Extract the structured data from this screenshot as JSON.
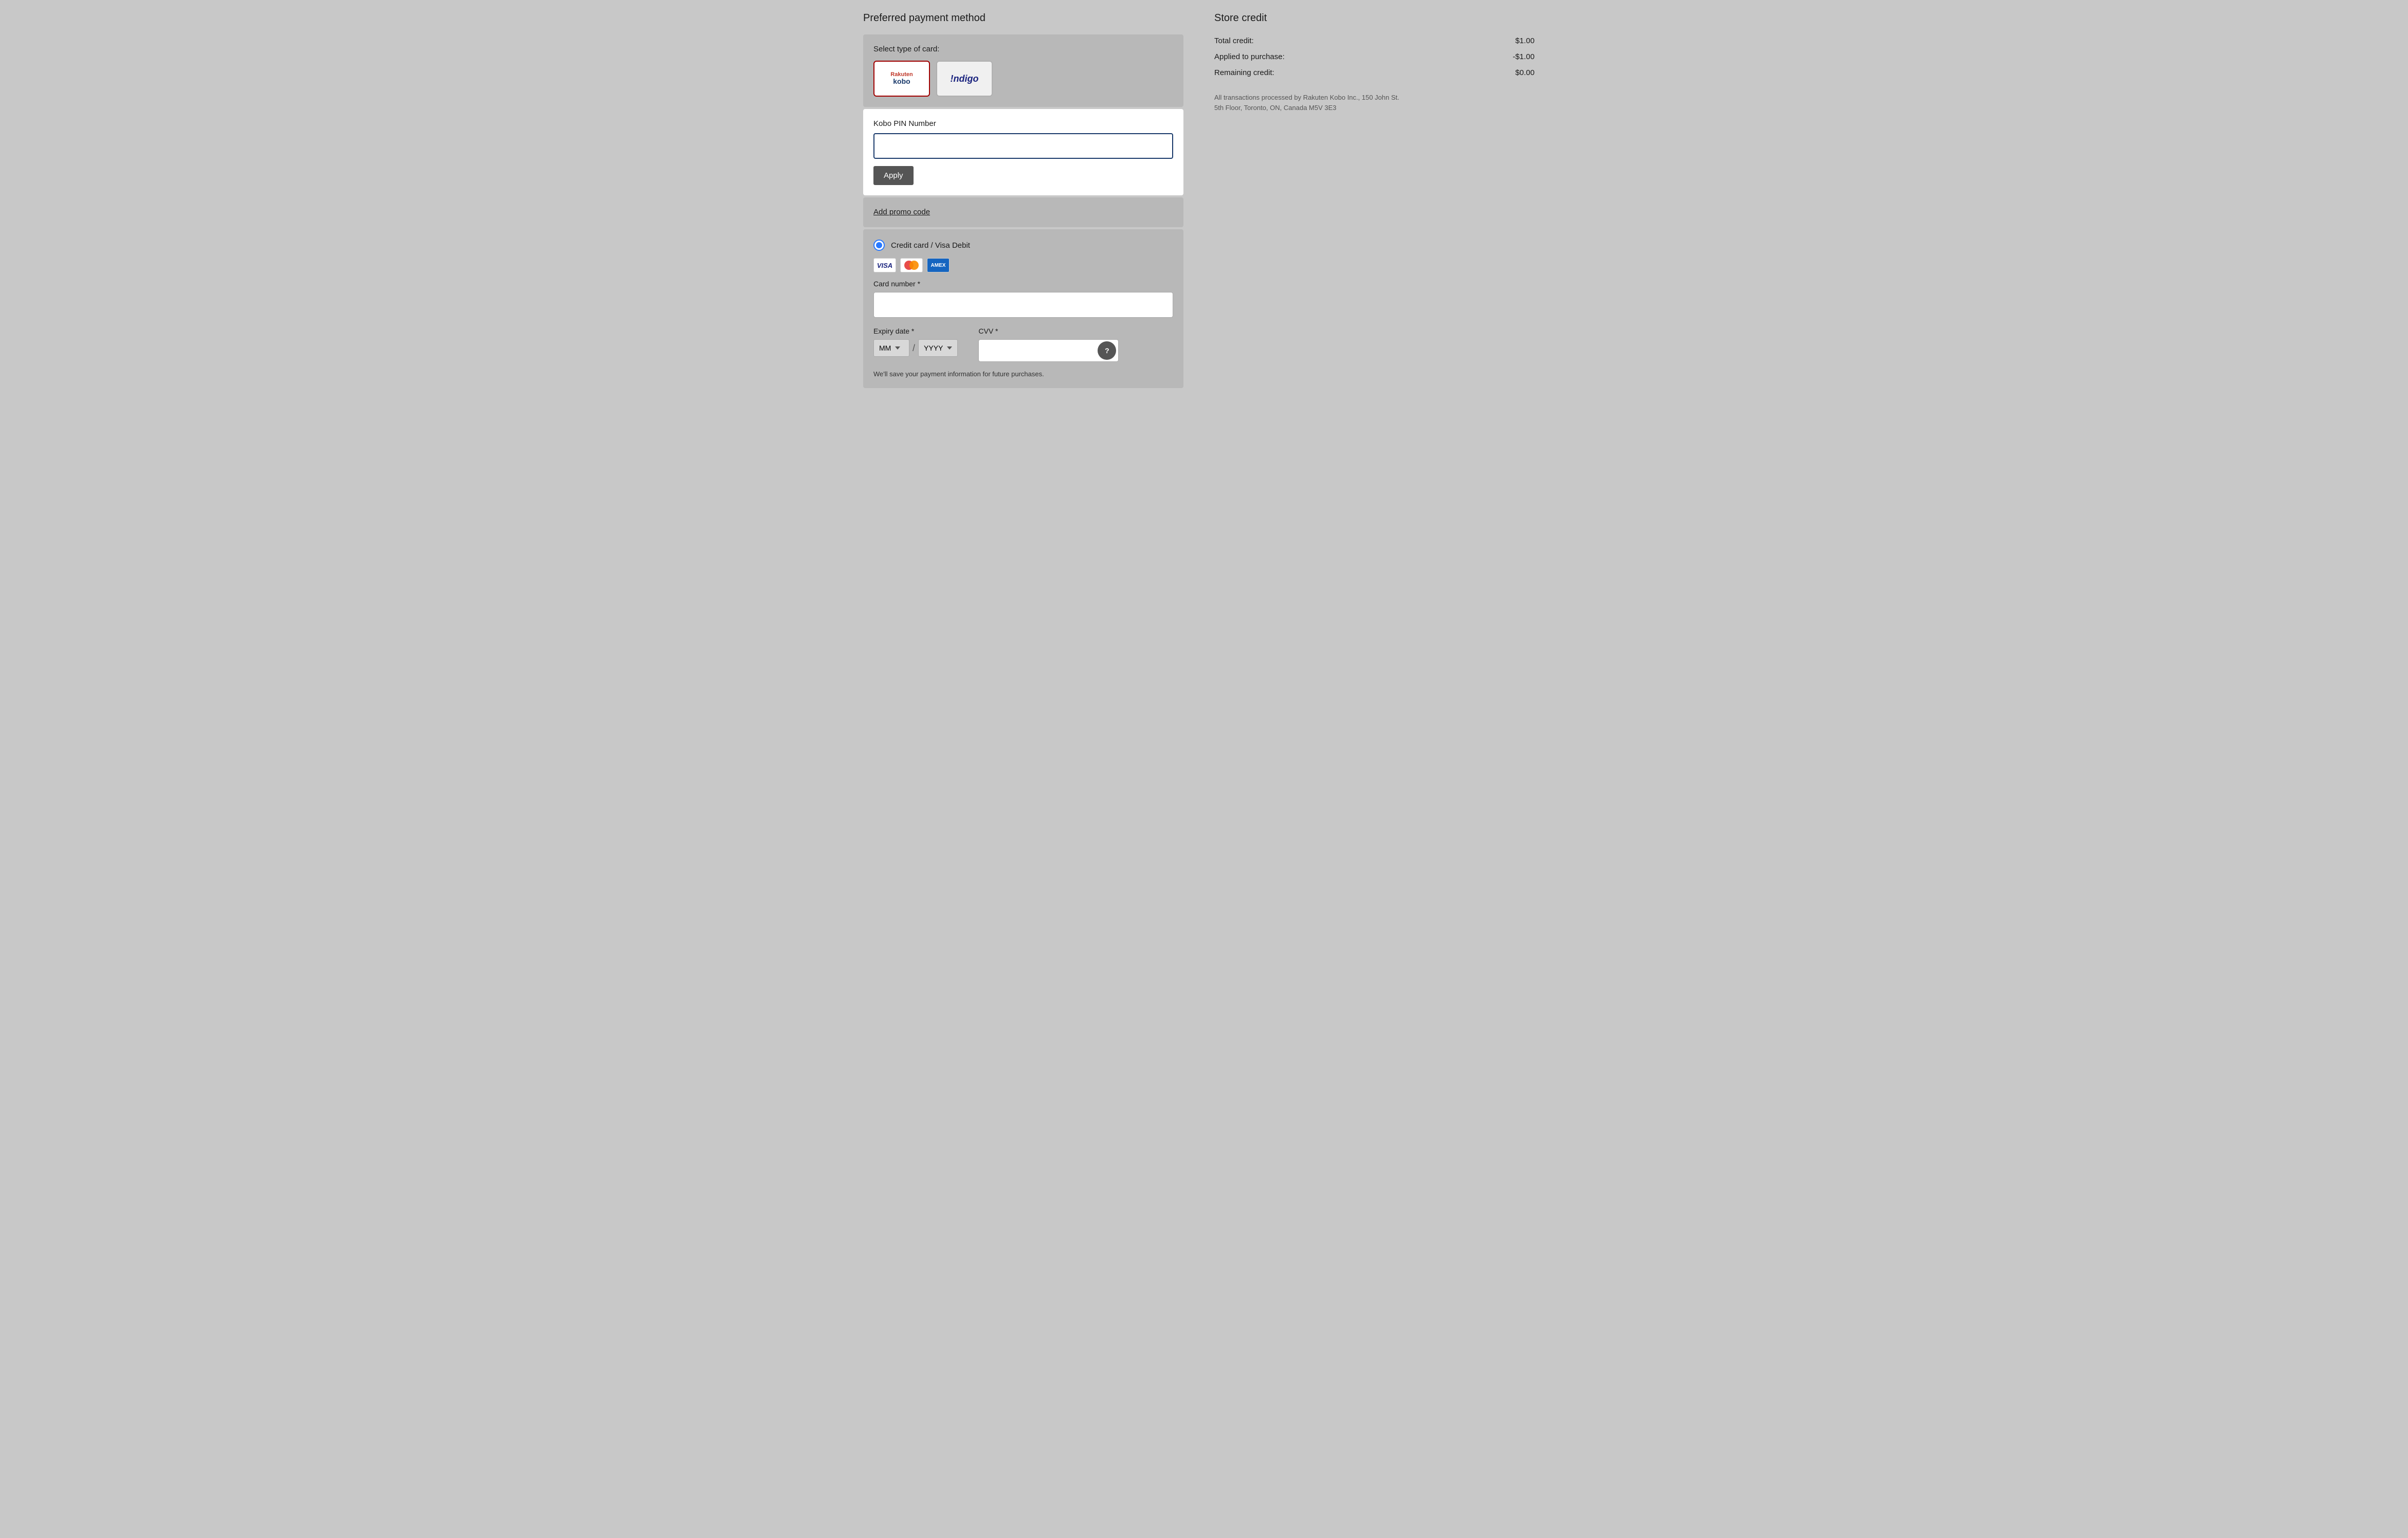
{
  "left": {
    "section_title": "Preferred payment method",
    "card_select": {
      "label": "Select type of card:",
      "cards": [
        {
          "id": "rakuten-kobo",
          "rakuten_text": "Rakuten",
          "kobo_text": "kobo",
          "selected": true
        },
        {
          "id": "indigo",
          "logo_text": "!ndigo",
          "selected": false
        }
      ]
    },
    "pin_section": {
      "label": "Kobo PIN Number",
      "placeholder": "",
      "apply_button": "Apply"
    },
    "promo": {
      "link_text": "Add promo code"
    },
    "credit_card": {
      "option_label": "Credit card / Visa Debit",
      "card_number_label": "Card number *",
      "card_number_placeholder": "",
      "expiry_label": "Expiry date *",
      "expiry_month_default": "MM",
      "expiry_year_default": "YYYY",
      "cvv_label": "CVV *",
      "cvv_placeholder": "",
      "save_info_text": "We'll save your payment information for future purchases."
    }
  },
  "right": {
    "store_credit": {
      "title": "Store credit",
      "rows": [
        {
          "label": "Total credit:",
          "value": "$1.00"
        },
        {
          "label": "Applied to purchase:",
          "value": "-$1.00"
        },
        {
          "label": "Remaining credit:",
          "value": "$0.00"
        }
      ],
      "notice": "All transactions processed by Rakuten Kobo Inc., 150 John St. 5th Floor, Toronto, ON, Canada M5V 3E3"
    }
  }
}
